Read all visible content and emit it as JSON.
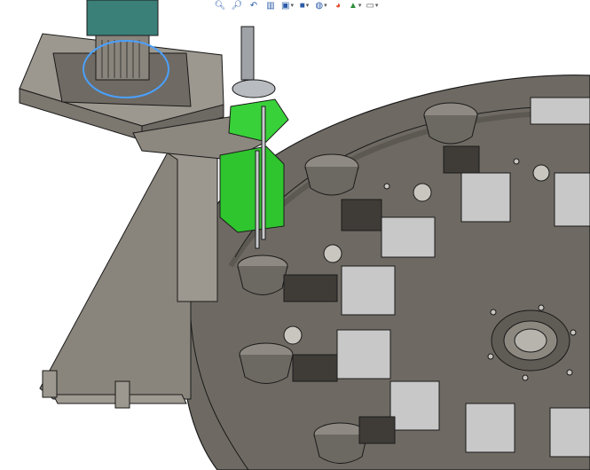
{
  "window": {
    "title": ""
  },
  "heads_up_toolbar": {
    "items": [
      {
        "name": "zoom-to-fit-icon",
        "glyph": "🔍︎",
        "dropdown": false
      },
      {
        "name": "zoom-to-area-icon",
        "glyph": "🔎︎",
        "dropdown": false
      },
      {
        "name": "previous-view-icon",
        "glyph": "↶",
        "dropdown": false
      },
      {
        "name": "section-view-icon",
        "glyph": "▥",
        "dropdown": false
      },
      {
        "name": "view-orientation-icon",
        "glyph": "▣",
        "dropdown": true
      },
      {
        "name": "display-style-icon",
        "glyph": "■",
        "dropdown": true
      },
      {
        "name": "hide-show-items-icon",
        "glyph": "◍",
        "dropdown": true
      },
      {
        "name": "edit-appearance-icon",
        "glyph": "◕",
        "dropdown": false
      },
      {
        "name": "apply-scene-icon",
        "glyph": "▲",
        "dropdown": true
      },
      {
        "name": "view-settings-icon",
        "glyph": "▭",
        "dropdown": true
      }
    ],
    "dropdown_glyph": "▾"
  },
  "model": {
    "description_colors": {
      "background": "#ffffff",
      "edges": "#1a1a1a",
      "turntable": "#6e6a63",
      "frame": "#8a857c",
      "gray_parts": "#9c988f",
      "highlight_green": "#2ec52e",
      "motor_teal": "#3a7f78",
      "selection_blue": "#4aa0ff"
    }
  }
}
